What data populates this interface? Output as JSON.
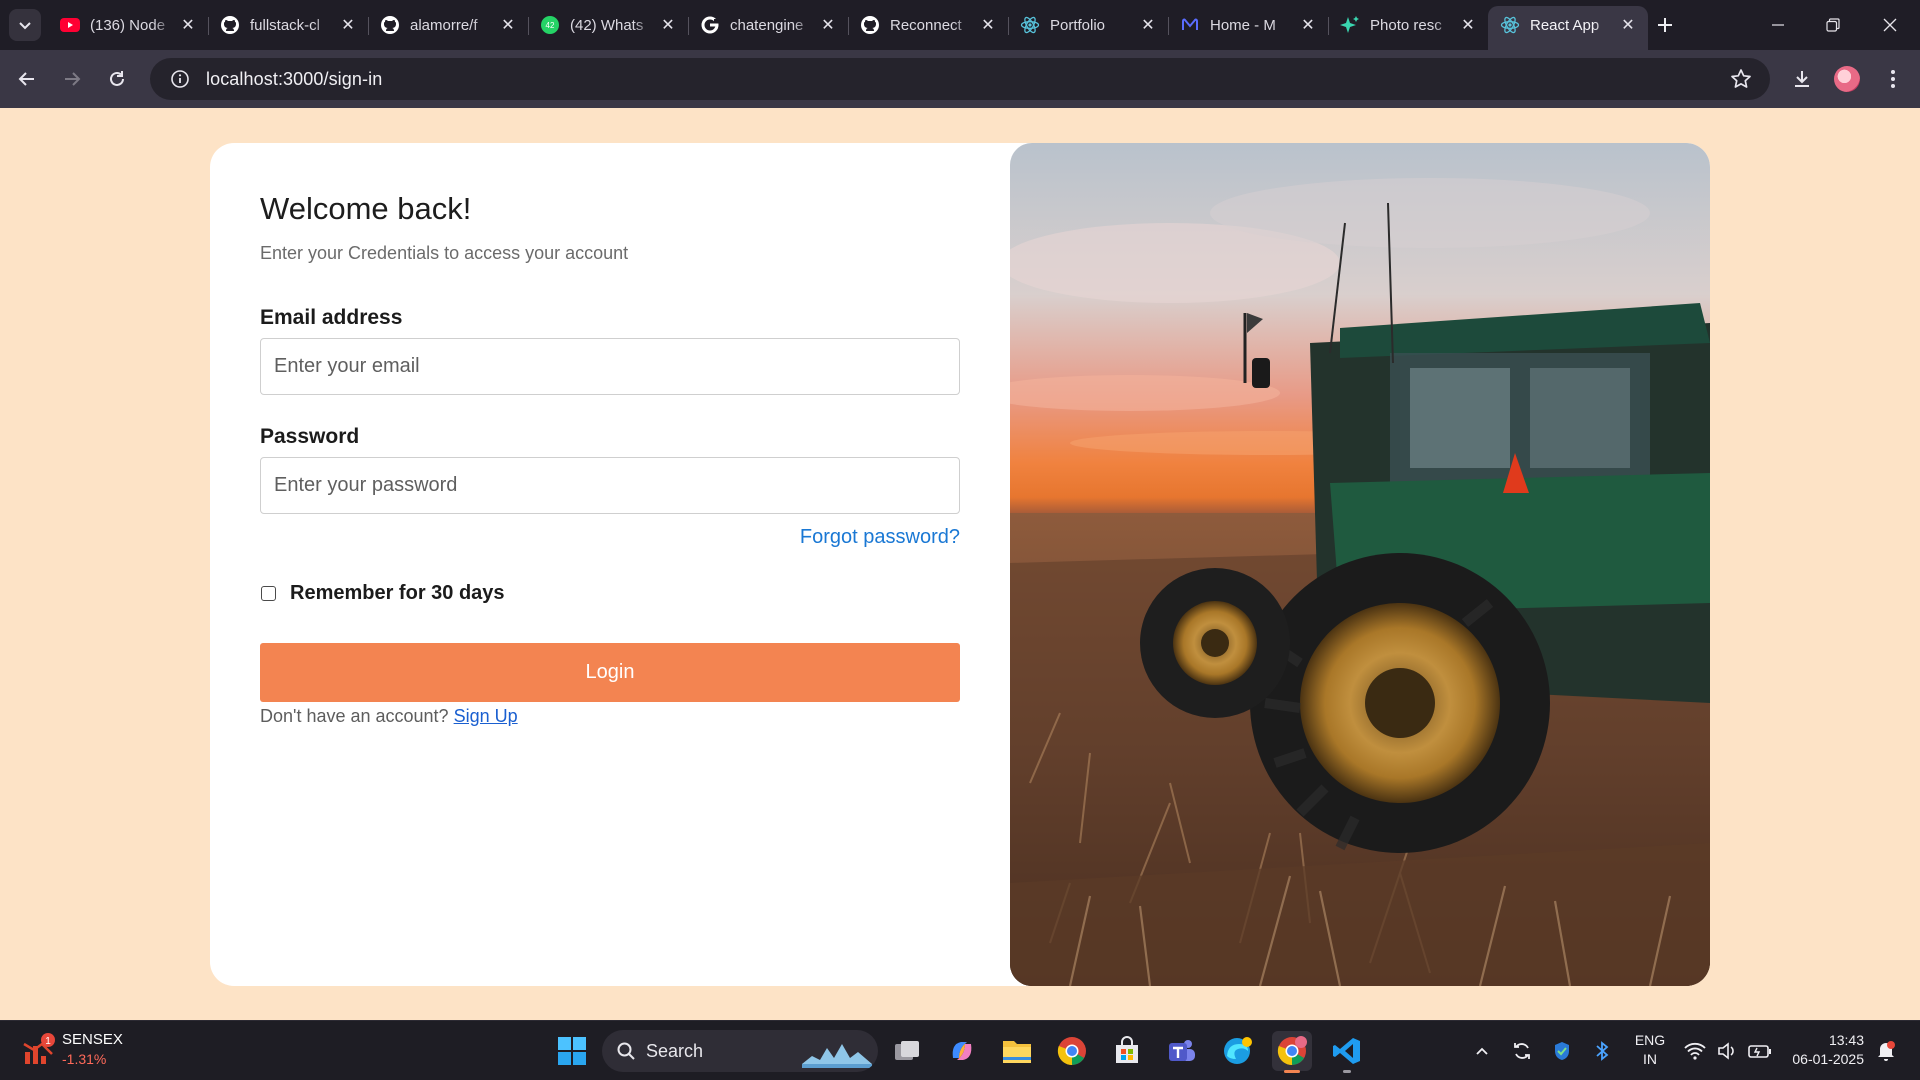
{
  "browser": {
    "tabs": [
      {
        "title": "(136) Node",
        "icon": "youtube-icon"
      },
      {
        "title": "fullstack-cl",
        "icon": "github-icon"
      },
      {
        "title": "alamorre/f",
        "icon": "github-icon"
      },
      {
        "title": "(42) Whats",
        "icon": "whatsapp-icon",
        "badge": "42"
      },
      {
        "title": "chatengine",
        "icon": "google-icon"
      },
      {
        "title": "Reconnect",
        "icon": "github-icon"
      },
      {
        "title": "Portfolio",
        "icon": "react-icon"
      },
      {
        "title": "Home - M",
        "icon": "meta-icon"
      },
      {
        "title": "Photo resc",
        "icon": "sparkle-icon"
      },
      {
        "title": "React App",
        "icon": "react-icon",
        "active": true
      }
    ],
    "url": "localhost:3000/sign-in"
  },
  "page": {
    "title": "Welcome back!",
    "subtitle": "Enter your Credentials to access your account",
    "email": {
      "label": "Email address",
      "placeholder": "Enter your email",
      "value": ""
    },
    "password": {
      "label": "Password",
      "placeholder": "Enter your password",
      "value": ""
    },
    "forgot_password": "Forgot password?",
    "remember": {
      "label": "Remember for 30 days",
      "checked": false
    },
    "login_button": "Login",
    "signup_prompt": "Don't have an account?",
    "signup_link": "Sign Up",
    "hero_image": "tractor-in-field-at-sunset",
    "colors": {
      "background": "#fde3c6",
      "accent": "#f38451",
      "link": "#1a78d4"
    }
  },
  "taskbar": {
    "widget": {
      "badge": "1",
      "name": "SENSEX",
      "delta": "-1.31%"
    },
    "search_label": "Search",
    "apps": [
      "start-icon",
      "search-icon",
      "task-view-icon",
      "copilot-icon",
      "file-explorer-icon",
      "chrome-icon",
      "store-icon",
      "teams-icon",
      "edge-icon",
      "chrome-profile-icon",
      "vscode-icon"
    ],
    "tray": {
      "language": "ENG",
      "region": "IN",
      "time": "13:43",
      "date": "06-01-2025"
    }
  }
}
